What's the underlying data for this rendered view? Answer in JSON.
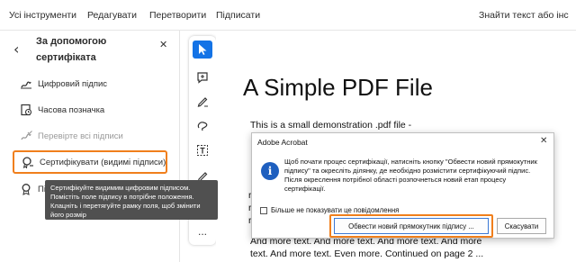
{
  "menu": {
    "items": [
      "Усі інструменти",
      "Редагувати",
      "Перетворити",
      "Підписати"
    ],
    "search_label": "Знайти текст або інс"
  },
  "panel": {
    "title": "За допомогою сертифіката",
    "items": [
      {
        "label": "Цифровий підпис",
        "icon": "digital-signature-icon",
        "state": "normal"
      },
      {
        "label": "Часова позначка",
        "icon": "timestamp-icon",
        "state": "normal"
      },
      {
        "label": "Перевірте всі підписи",
        "icon": "verify-signatures-icon",
        "state": "disabled"
      },
      {
        "label": "Сертифікувати (видимі підписи)",
        "icon": "certify-visible-icon",
        "state": "selected"
      },
      {
        "label": "Пі",
        "icon": "certify-invisible-icon",
        "state": "normal"
      }
    ],
    "tooltip": "Сертифікуйте видимим цифровим підписом. Помістіть поле підпису в потрібне положення. Клацніть і перетягуйте рамку поля, щоб змінити його розмір"
  },
  "rail": {
    "tools": [
      "select-cursor-icon",
      "add-comment-icon",
      "draw-pen-icon",
      "draw-shape-icon",
      "text-select-icon",
      "sign-icon",
      "more-tools-icon"
    ],
    "more_label": "..."
  },
  "document": {
    "heading": "A Simple PDF File",
    "intro": "This is a small demonstration .pdf file -",
    "fragments": [
      "r",
      "r",
      "r"
    ],
    "line_a": "And more text. And more text. And more text. And more",
    "line_b": "text. And more text. Even more. Continued on page 2 ..."
  },
  "dialog": {
    "title": "Adobe Acrobat",
    "message": "Щоб почати процес сертифікації, натисніть кнопку \"Обвести новий прямокутник підпису\" та окресліть ділянку, де необхідно розмістити сертифікуючий підпис. Після окреслення потрібної області розпочнеться новий етап процесу сертифікації.",
    "checkbox_label": "Більше не показувати це повідомлення",
    "primary_button": "Обвести новий прямокутник підпису ...",
    "cancel_button": "Скасувати"
  },
  "colors": {
    "accent": "#1473e6",
    "highlight": "#f07f1c",
    "tooltip_bg": "#505050",
    "info_icon": "#1e5fbf"
  }
}
